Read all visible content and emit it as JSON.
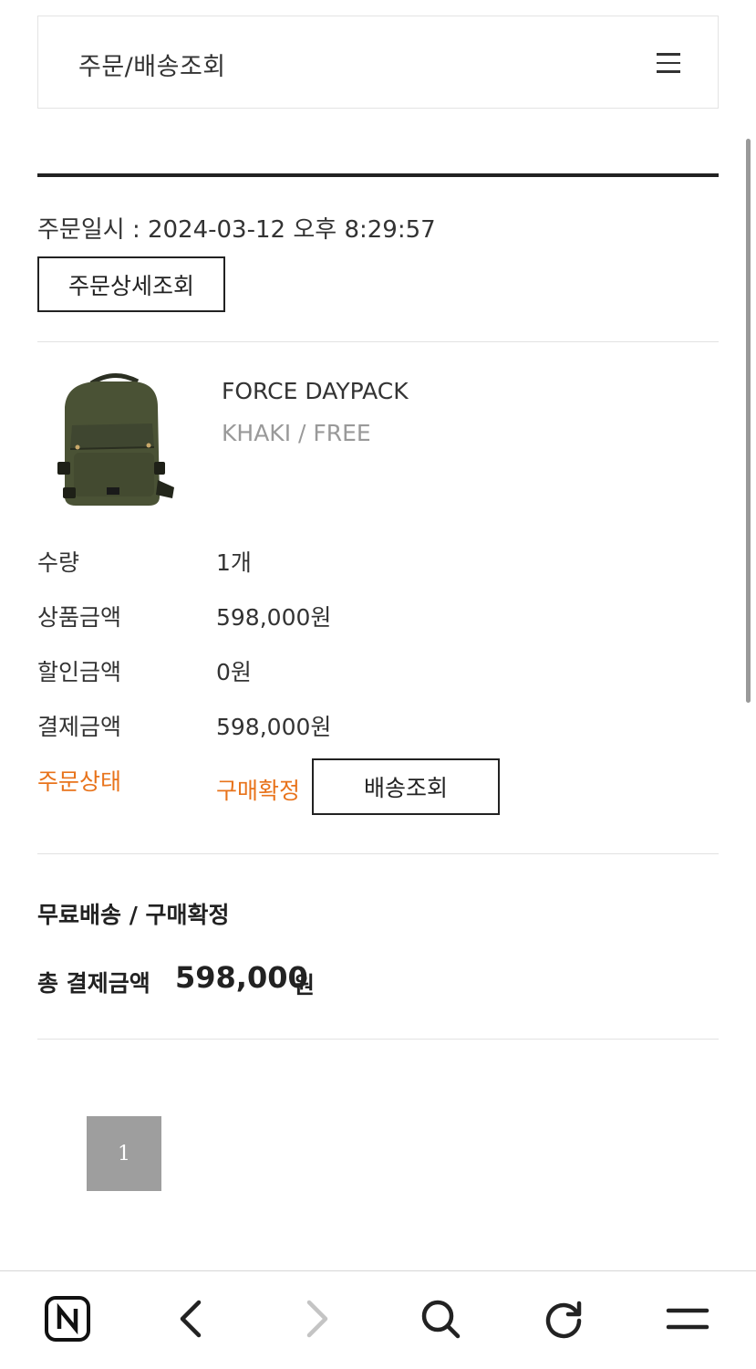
{
  "header": {
    "title": "주문/배송조회",
    "menu_icon": "hamburger-icon"
  },
  "order": {
    "date_text": "주문일시 : 2024-03-12 오후 8:29:57",
    "detail_button_label": "주문상세조회"
  },
  "product": {
    "image_icon": "backpack-image",
    "name": "FORCE DAYPACK",
    "option": "KHAKI / FREE"
  },
  "details": [
    {
      "label": "수량",
      "value": "1개"
    },
    {
      "label": "상품금액",
      "value": "598,000원"
    },
    {
      "label": "할인금액",
      "value": "0원"
    },
    {
      "label": "결제금액",
      "value": "598,000원"
    }
  ],
  "status": {
    "label": "주문상태",
    "value": "구매확정",
    "button_label": "배송조회"
  },
  "summary": {
    "title": "무료배송 / 구매확정",
    "total_label": "총 결제금액",
    "total_amount": "598,000",
    "total_unit": "원"
  },
  "pagination": {
    "current_page": "1"
  },
  "bottom_nav": {
    "items": [
      "naver-home-icon",
      "back-icon",
      "forward-icon",
      "search-icon",
      "refresh-icon",
      "menu-icon"
    ]
  },
  "colors": {
    "accent_orange": "#e8731b",
    "text_dark": "#222222",
    "text_muted": "#999999",
    "page_button_bg": "#9e9e9e"
  }
}
